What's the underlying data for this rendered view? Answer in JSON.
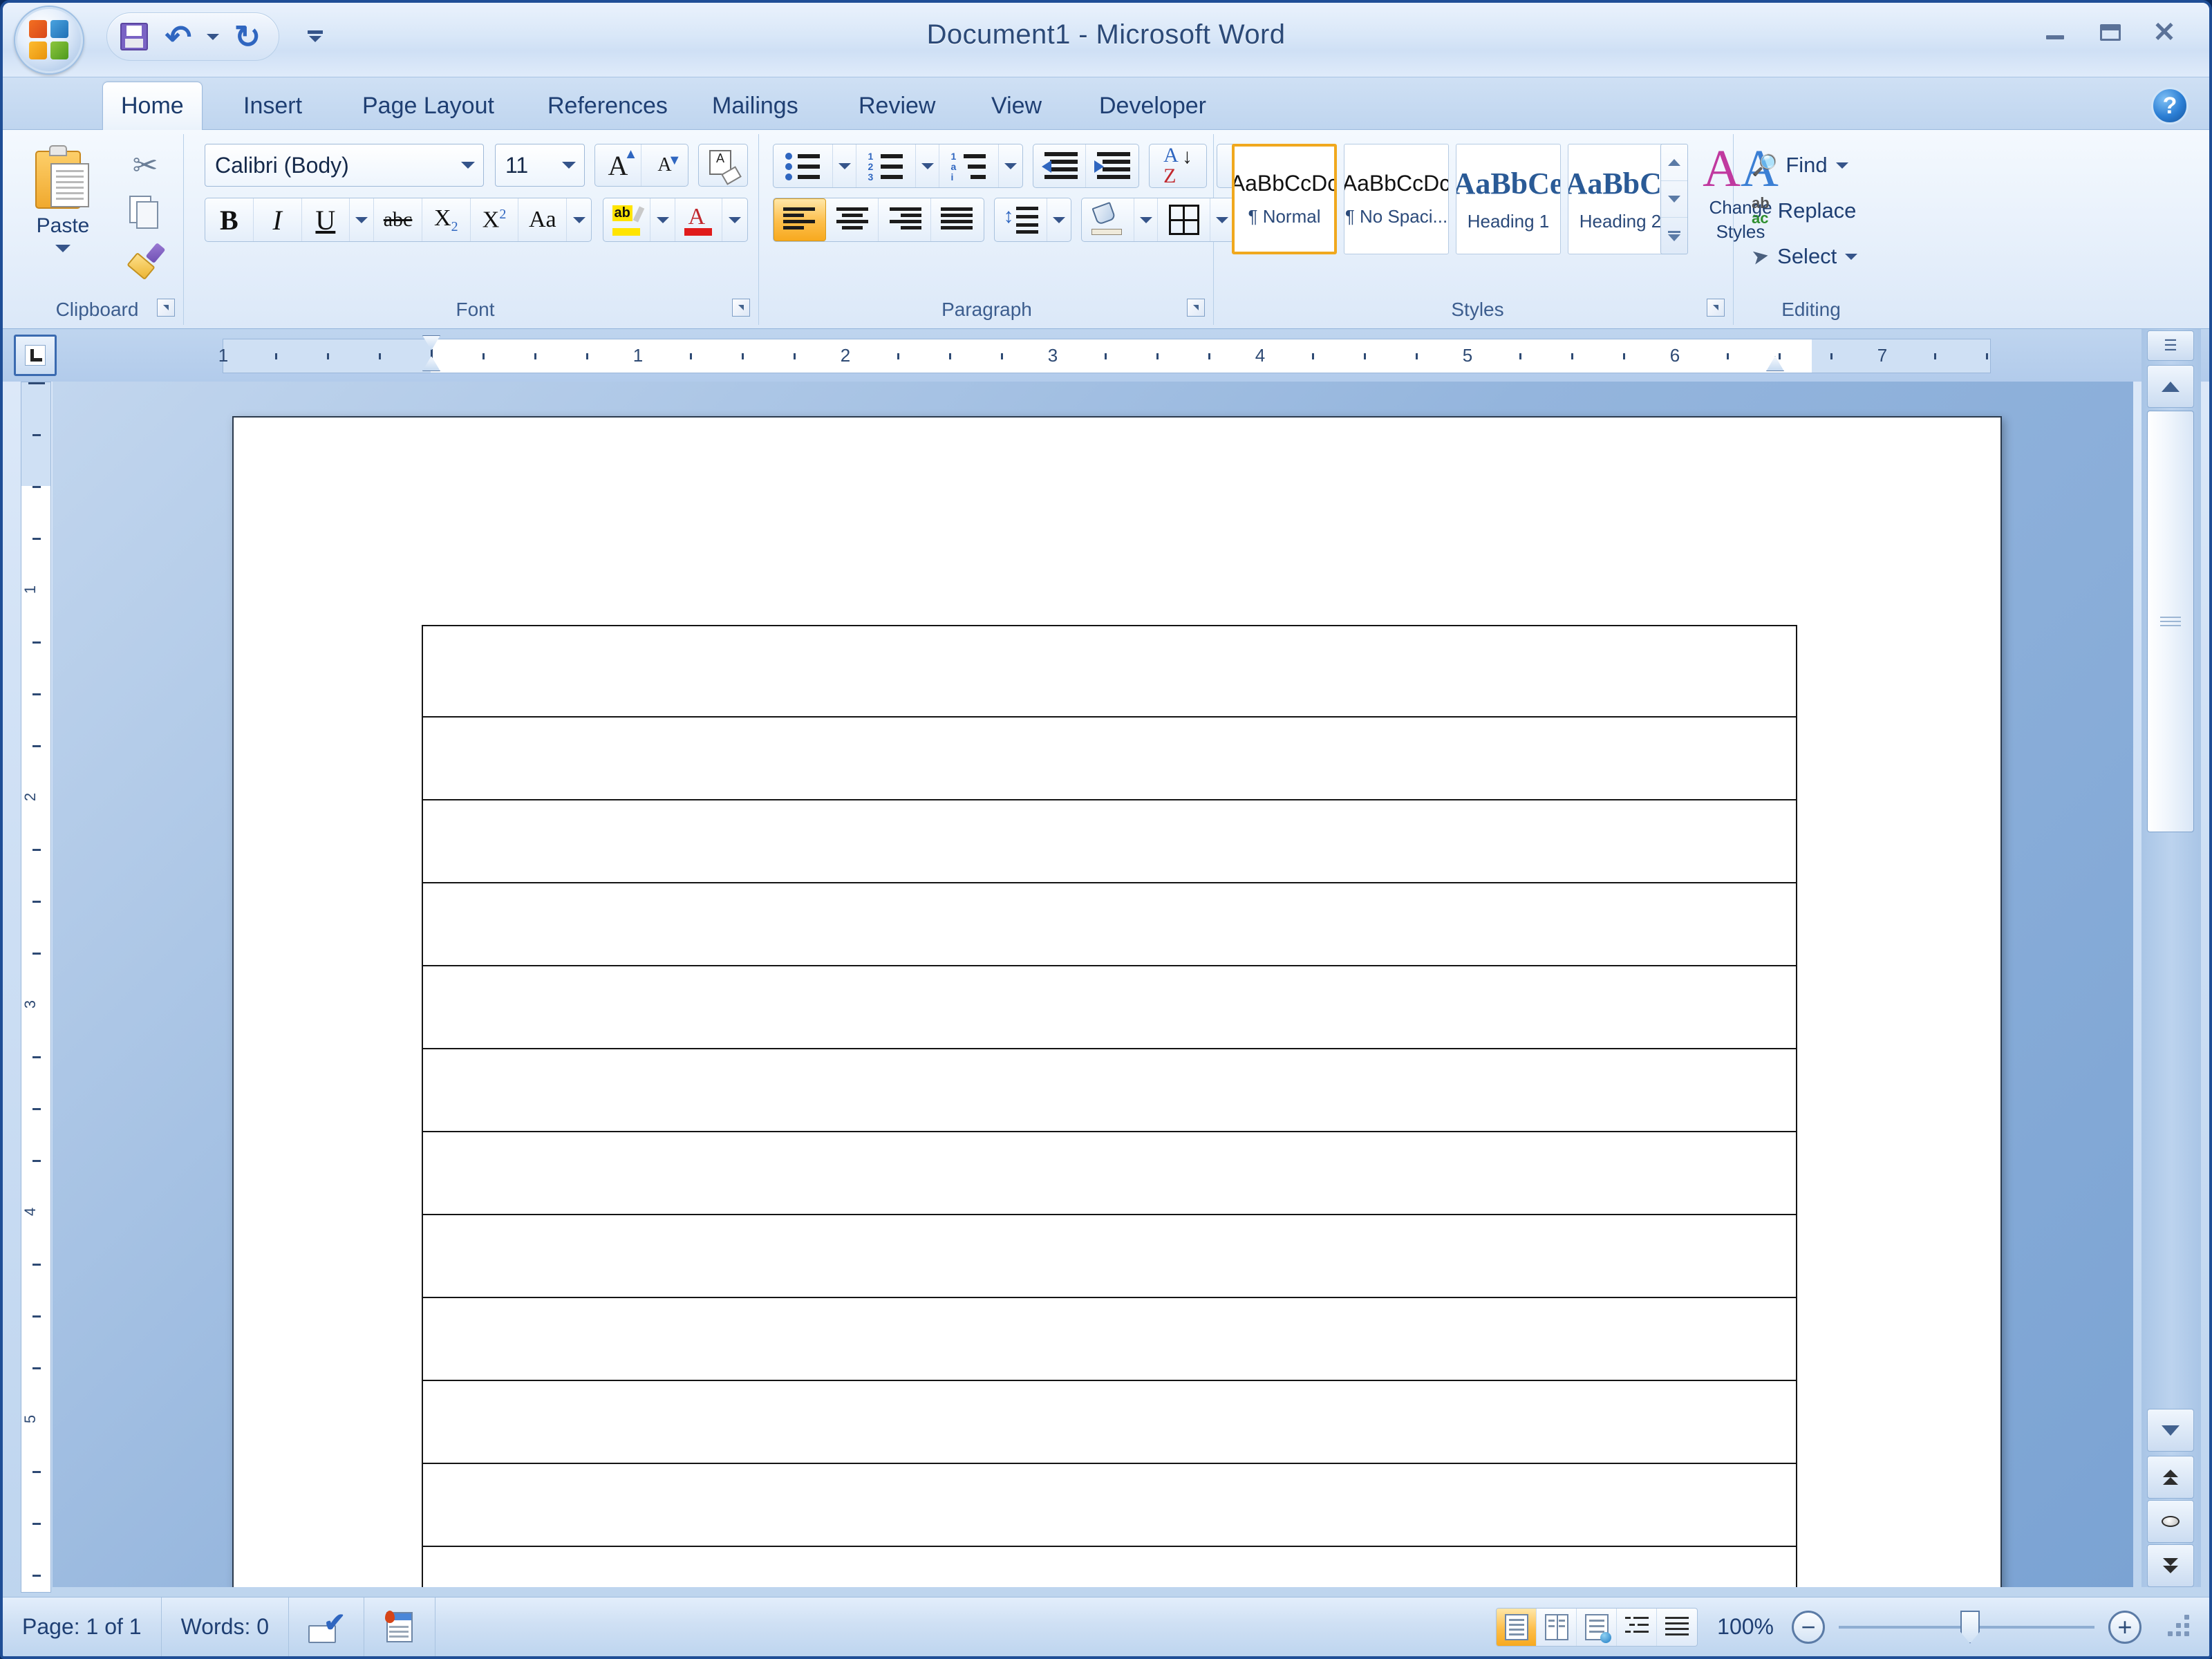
{
  "window": {
    "title": "Document1 - Microsoft Word",
    "minimize_label": "Minimize",
    "maximize_label": "Maximize",
    "close_label": "Close",
    "help_label": "?"
  },
  "quick_access": {
    "items": [
      {
        "icon": "save-icon",
        "label": "Save"
      },
      {
        "icon": "undo-icon",
        "label": "Undo",
        "glyph": "↶"
      },
      {
        "icon": "redo-icon",
        "label": "Redo",
        "glyph": "↻"
      }
    ],
    "customize_label": "Customize Quick Access Toolbar"
  },
  "ribbon": {
    "tabs": [
      {
        "label": "Home",
        "active": true
      },
      {
        "label": "Insert",
        "active": false
      },
      {
        "label": "Page Layout",
        "active": false
      },
      {
        "label": "References",
        "active": false
      },
      {
        "label": "Mailings",
        "active": false
      },
      {
        "label": "Review",
        "active": false
      },
      {
        "label": "View",
        "active": false
      },
      {
        "label": "Developer",
        "active": false
      }
    ],
    "groups": {
      "clipboard": {
        "label": "Clipboard",
        "paste_label": "Paste",
        "cut_label": "Cut",
        "copy_label": "Copy",
        "format_painter_label": "Format Painter"
      },
      "font": {
        "label": "Font",
        "font_name": "Calibri (Body)",
        "font_size": "11",
        "grow_label": "Grow Font",
        "shrink_label": "Shrink Font",
        "clear_formatting_label": "Clear Formatting",
        "bold_label": "B",
        "italic_label": "I",
        "underline_label": "U",
        "strikethrough_label": "abc",
        "subscript_label": "X",
        "subscript_sub": "2",
        "superscript_label": "X",
        "superscript_sup": "2",
        "change_case_label": "Aa",
        "highlight_label": "ab",
        "font_color_label": "A",
        "highlight_color": "#ffe400",
        "font_color": "#e01b1b"
      },
      "paragraph": {
        "label": "Paragraph",
        "bullets_label": "Bullets",
        "numbering_label": "Numbering",
        "multilevel_label": "Multilevel List",
        "decrease_indent_label": "Decrease Indent",
        "increase_indent_label": "Increase Indent",
        "sort_label": "Sort",
        "show_marks_label": "¶",
        "align_left_label": "Align Text Left",
        "align_center_label": "Center",
        "align_right_label": "Align Text Right",
        "justify_label": "Justify",
        "line_spacing_label": "Line Spacing",
        "shading_label": "Shading",
        "borders_label": "Borders",
        "active_alignment": "align-left"
      },
      "styles": {
        "label": "Styles",
        "gallery": [
          {
            "sample": "AaBbCcDc",
            "name": "¶ Normal",
            "selected": true,
            "heading": false
          },
          {
            "sample": "AaBbCcDc",
            "name": "¶ No Spaci...",
            "selected": false,
            "heading": false
          },
          {
            "sample": "AaBbCе",
            "name": "Heading 1",
            "selected": false,
            "heading": true
          },
          {
            "sample": "AaBbCc",
            "name": "Heading 2",
            "selected": false,
            "heading": true
          }
        ],
        "change_styles_line1": "Change",
        "change_styles_line2": "Styles"
      },
      "editing": {
        "label": "Editing",
        "find_label": "Find",
        "replace_label": "Replace",
        "select_label": "Select"
      }
    }
  },
  "ruler": {
    "tab_selector_label": "Left Tab",
    "horizontal_numbers": [
      "1",
      "1",
      "2",
      "3",
      "4",
      "5",
      "6",
      "7"
    ],
    "vertical_numbers": [
      "1",
      "2",
      "3",
      "4"
    ],
    "left_indent_inches": 1.0,
    "right_indent_inches": 6.5,
    "units": "inches"
  },
  "document": {
    "page_background": "#ffffff",
    "table": {
      "columns": 1,
      "row_count": 12,
      "rows": [
        {
          "cells": [
            ""
          ]
        },
        {
          "cells": [
            ""
          ]
        },
        {
          "cells": [
            ""
          ]
        },
        {
          "cells": [
            ""
          ]
        },
        {
          "cells": [
            ""
          ]
        },
        {
          "cells": [
            ""
          ]
        },
        {
          "cells": [
            ""
          ]
        },
        {
          "cells": [
            ""
          ]
        },
        {
          "cells": [
            ""
          ]
        },
        {
          "cells": [
            ""
          ]
        },
        {
          "cells": [
            ""
          ]
        },
        {
          "cells": [
            ""
          ]
        }
      ],
      "border_color": "#141414"
    }
  },
  "scrollbar": {
    "split_label": "Split",
    "scroll_up_label": "Scroll Up",
    "scroll_down_label": "Scroll Down",
    "previous_page_label": "Previous Page",
    "browse_object_label": "Select Browse Object",
    "next_page_label": "Next Page"
  },
  "status_bar": {
    "page_text": "Page: 1 of 1",
    "words_text": "Words: 0",
    "proofing_label": "Proofing errors",
    "language_label": "Language",
    "views": [
      {
        "name": "print-layout",
        "active": true
      },
      {
        "name": "full-screen-reading",
        "active": false
      },
      {
        "name": "web-layout",
        "active": false
      },
      {
        "name": "outline",
        "active": false
      },
      {
        "name": "draft",
        "active": false
      }
    ],
    "zoom_text": "100%",
    "zoom_out_label": "−",
    "zoom_in_label": "+",
    "zoom_value": 100
  },
  "colors": {
    "accent_orange": "#f7a91f",
    "ribbon_blue": "#1f3f73",
    "window_border": "#1f4e96",
    "canvas_blue": "#7ba3d3"
  }
}
